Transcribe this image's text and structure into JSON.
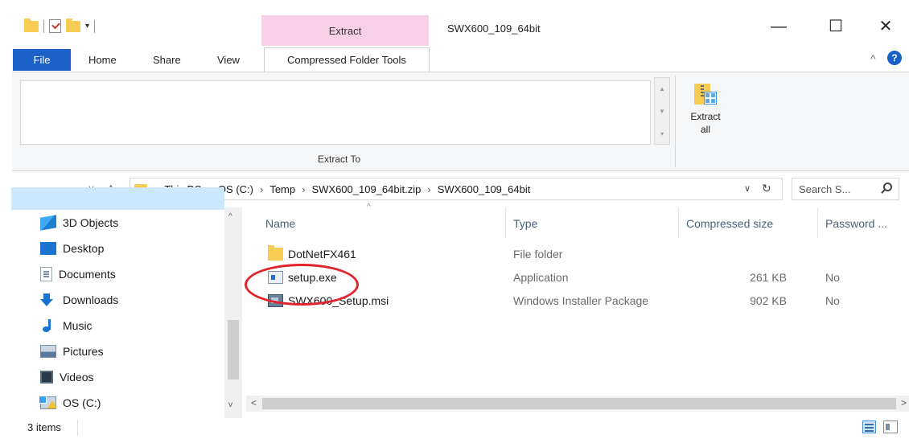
{
  "title_bar": {
    "context_tab_header": "Extract",
    "window_title": "SWX600_109_64bit",
    "minimize_glyph": "—",
    "maximize_glyph": "☐",
    "close_glyph": "✕",
    "qat_dropdown_glyph": "▾"
  },
  "ribbon_tabs": {
    "file": "File",
    "home": "Home",
    "share": "Share",
    "view": "View",
    "compressed_folder_tools": "Compressed Folder Tools",
    "collapse_glyph": "^",
    "help_glyph": "?"
  },
  "ribbon": {
    "extract_to_label": "Extract To",
    "extract_all_line1": "Extract",
    "extract_all_line2": "all"
  },
  "address_bar": {
    "back_glyph": "←",
    "forward_glyph": "→",
    "recent_glyph": "˅",
    "up_glyph": "↑",
    "breadcrumbs": [
      "This PC",
      "OS (C:)",
      "Temp",
      "SWX600_109_64bit.zip",
      "SWX600_109_64bit"
    ],
    "separator_glyph": "›",
    "dropdown_glyph": "∨",
    "refresh_glyph": "↻",
    "search_placeholder": "Search S..."
  },
  "nav_pane": {
    "items": [
      {
        "label": "3D Objects",
        "icon": "3d-objects-icon"
      },
      {
        "label": "Desktop",
        "icon": "desktop-icon"
      },
      {
        "label": "Documents",
        "icon": "documents-icon"
      },
      {
        "label": "Downloads",
        "icon": "downloads-icon"
      },
      {
        "label": "Music",
        "icon": "music-icon"
      },
      {
        "label": "Pictures",
        "icon": "pictures-icon"
      },
      {
        "label": "Videos",
        "icon": "videos-icon"
      },
      {
        "label": "OS (C:)",
        "icon": "drive-icon"
      }
    ],
    "selected": "OS (C:)"
  },
  "file_list": {
    "columns": [
      "Name",
      "Type",
      "Compressed size",
      "Password ..."
    ],
    "sort_glyph": "^",
    "rows": [
      {
        "name": "DotNetFX461",
        "type": "File folder",
        "size": "",
        "password": "",
        "icon": "folder-icon"
      },
      {
        "name": "setup.exe",
        "type": "Application",
        "size": "261 KB",
        "password": "No",
        "icon": "application-icon"
      },
      {
        "name": "SWX600_Setup.msi",
        "type": "Windows Installer Package",
        "size": "902 KB",
        "password": "No",
        "icon": "installer-package-icon"
      }
    ],
    "highlight_color": "#e0242b"
  },
  "scrollbars": {
    "left_glyph": "<",
    "right_glyph": ">",
    "up_glyph": "^",
    "down_glyph": "v"
  },
  "status_bar": {
    "item_count": "3 items"
  },
  "colors": {
    "file_tab": "#1a61c7",
    "context_tab_header": "#f7cfe6",
    "selection": "#cce8ff",
    "folder": "#f7cc55"
  }
}
